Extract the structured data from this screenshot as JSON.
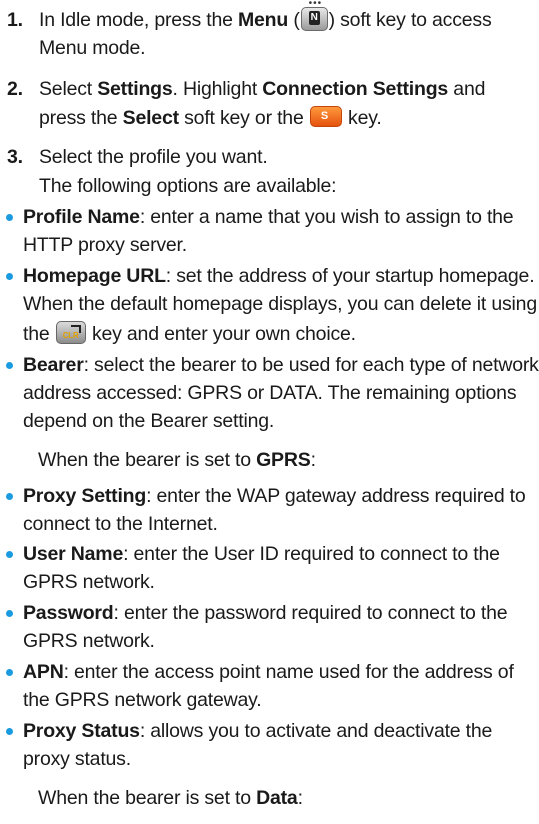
{
  "steps": [
    {
      "number": "1.",
      "line1": {
        "a": "In Idle mode, press the ",
        "b": "Menu",
        "c": " (",
        "d": ") soft key to access"
      },
      "line2": "Menu mode."
    },
    {
      "number": "2.",
      "line1": {
        "a": "Select ",
        "b": "Settings",
        "c": ". Highlight ",
        "d": "Connection Settings",
        "e": " and"
      },
      "line2": {
        "a": "press the ",
        "b": "Select",
        "c": " soft key or the ",
        "d": " key."
      }
    },
    {
      "number": "3.",
      "line1": "Select the profile you want.",
      "line2": "The following options are available:"
    }
  ],
  "keys": {
    "menu_icon": "menu-key-icon",
    "menu_glyph": "N",
    "menu_dots": "•••",
    "select_icon": "select-key-icon",
    "select_glyph": "S",
    "clear_icon": "clear-key-icon",
    "clear_glyph": "CLR"
  },
  "options": [
    {
      "term": "Profile Name",
      "lines": [
        ": enter a name that you wish to assign to the",
        "HTTP proxy server."
      ]
    },
    {
      "term": "Homepage URL",
      "lines": [
        ": set the address of your startup homepage.",
        "When the default homepage displays, you can delete it using"
      ],
      "line3a": "the ",
      "line3b": " key and enter your own choice."
    },
    {
      "term": "Bearer",
      "lines": [
        ": select the bearer to be used for each type of network",
        "address accessed: GPRS or DATA. The remaining options",
        "depend on the Bearer setting."
      ]
    }
  ],
  "gprs_intro": {
    "a": "When the bearer is set to ",
    "b": "GPRS",
    "c": ":"
  },
  "gprs_options": [
    {
      "term": "Proxy Setting",
      "lines": [
        ": enter the WAP gateway address required to",
        "connect to the Internet."
      ]
    },
    {
      "term": "User Name",
      "lines": [
        ": enter the User ID required to connect to the",
        "GPRS network."
      ]
    },
    {
      "term": "Password",
      "lines": [
        ": enter the password required to connect to the",
        "GPRS network."
      ]
    },
    {
      "term": "APN",
      "lines": [
        ": enter the access point name used for the address of",
        "the GPRS network gateway."
      ]
    },
    {
      "term": "Proxy Status",
      "lines": [
        ": allows you to activate and deactivate the",
        "proxy status."
      ]
    }
  ],
  "data_intro": {
    "a": "When the bearer is set to ",
    "b": "Data",
    "c": ":"
  },
  "colors": {
    "bullet": "#1a9be0",
    "select_key": "#f07020",
    "text": "#1a1a1a"
  }
}
